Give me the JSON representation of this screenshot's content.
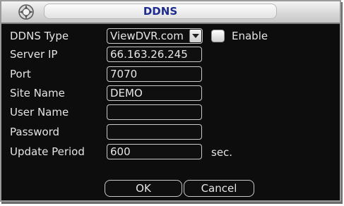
{
  "window": {
    "title": "DDNS",
    "title_color": "#1f2c8f",
    "icon": "dvr-logo-icon"
  },
  "form": {
    "ddns_type": {
      "label": "DDNS Type",
      "value": "ViewDVR.com"
    },
    "enable": {
      "label": "Enable",
      "checked": false
    },
    "server_ip": {
      "label": "Server IP",
      "value": "66.163.26.245"
    },
    "port": {
      "label": "Port",
      "value": "7070"
    },
    "site_name": {
      "label": "Site Name",
      "value": "DEMO"
    },
    "user_name": {
      "label": "User Name",
      "value": ""
    },
    "password": {
      "label": "Password",
      "value": ""
    },
    "update_period": {
      "label": "Update Period",
      "value": "600",
      "unit": "sec."
    }
  },
  "buttons": {
    "ok": "OK",
    "cancel": "Cancel"
  }
}
